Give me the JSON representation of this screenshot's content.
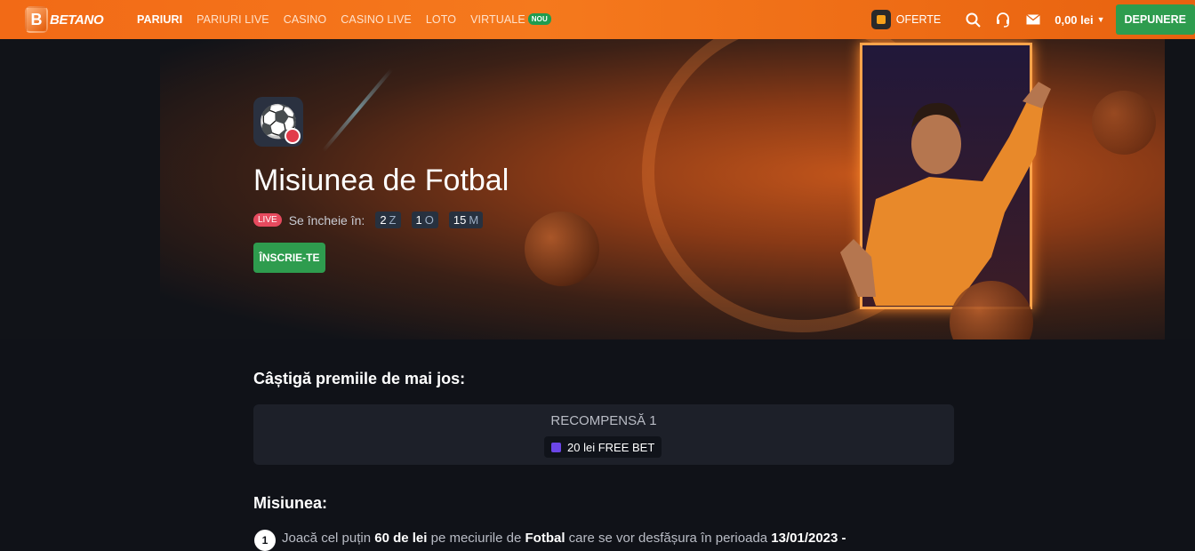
{
  "brand": {
    "logo_text": "BETANO"
  },
  "nav": {
    "items": [
      {
        "label": "PARIURI",
        "active": true
      },
      {
        "label": "PARIURI LIVE"
      },
      {
        "label": "CASINO"
      },
      {
        "label": "CASINO LIVE"
      },
      {
        "label": "LOTO"
      },
      {
        "label": "VIRTUALE",
        "badge": "NOU"
      }
    ]
  },
  "header": {
    "offers_label": "OFERTE",
    "balance": "0,00 lei",
    "deposit_label": "DEPUNERE",
    "icons": [
      "gift-icon",
      "search-icon",
      "headset-icon",
      "mail-icon",
      "caret-down-icon"
    ]
  },
  "hero": {
    "title": "Misiunea de Fotbal",
    "live_badge": "LIVE",
    "ends_label": "Se încheie în:",
    "timer": [
      {
        "value": "2",
        "unit": "Z"
      },
      {
        "value": "1",
        "unit": "O"
      },
      {
        "value": "15",
        "unit": "M"
      }
    ],
    "join_label": "ÎNSCRIE-TE"
  },
  "rewards": {
    "heading": "Câștigă premiile de mai jos:",
    "card_title": "RECOMPENSĂ 1",
    "prize": "20 lei FREE BET"
  },
  "mission": {
    "heading": "Misiunea:",
    "steps": [
      {
        "number": "1",
        "t1": "Joacă cel puțin ",
        "b1": "60 de lei",
        "t2": " pe meciurile de ",
        "b2": "Fotbal",
        "t3": " care se vor desfășura în perioada ",
        "b3": "13/01/2023 -"
      }
    ]
  },
  "colors": {
    "brand_orange": "#f26a16",
    "green": "#2e9c4e",
    "live_red": "#e64a5e",
    "background": "#101218"
  }
}
